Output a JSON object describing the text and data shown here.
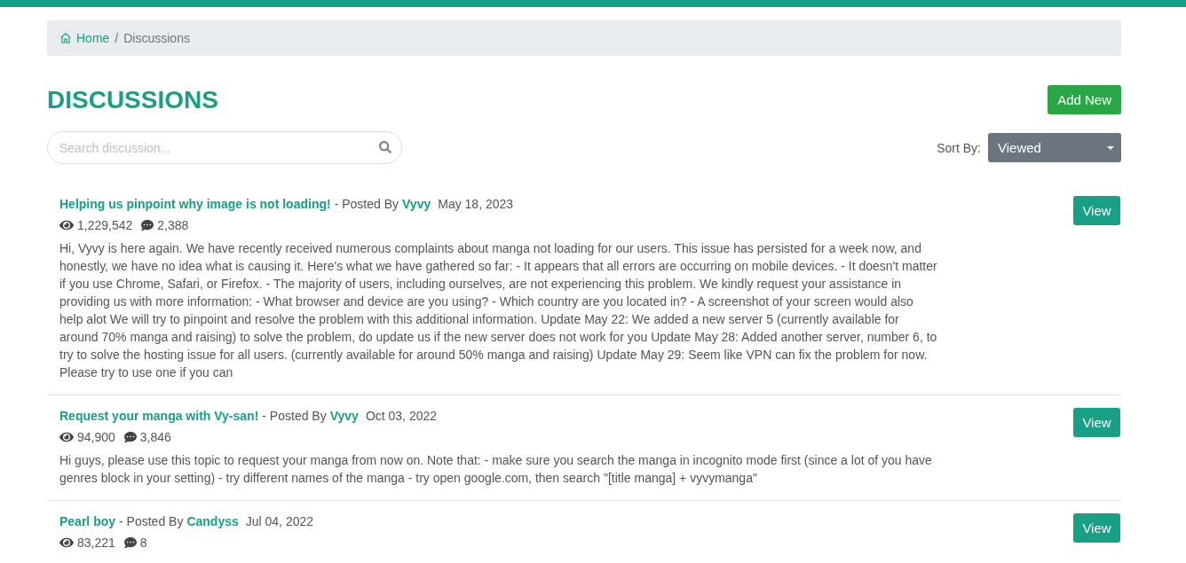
{
  "breadcrumb": {
    "separator": "/",
    "items": [
      {
        "label": "Home",
        "kind": "link"
      },
      {
        "label": "Discussions",
        "kind": "current"
      }
    ]
  },
  "page_title": "DISCUSSIONS",
  "add_button": "Add New",
  "search": {
    "placeholder": "Search discussion..."
  },
  "sort": {
    "label": "Sort By:",
    "value": "Viewed"
  },
  "topics": [
    {
      "title": "Helping us pinpoint why image is not loading!",
      "posted_by": "- Posted By",
      "author": "Vyvy",
      "date": "May 18, 2023",
      "views": "1,229,542",
      "comments": "2,388",
      "body": "Hi, Vyvy is here again. We have recently received numerous complaints about manga not loading for our users. This issue has persisted for a week now, and honestly, we have no idea what is causing it. Here's what we have gathered so far: - It appears that all errors are occurring on mobile devices. - It doesn't matter if you use Chrome, Safari, or Firefox. - The majority of users, including ourselves, are not experiencing this problem. We kindly request your assistance in providing us with more information: - What browser and device are you using? - Which country are you located in? - A screenshot of your screen would also help alot We will try to pinpoint and resolve the problem with this additional information. Update May 22: We added a new server 5 (currently available for around 70% manga and raising) to solve the problem, do update us if the new server does not work for you Update May 28: Added another server, number 6, to try to solve the hosting issue for all users. (currently available for around 50% manga and raising) Update May 29: Seem like VPN can fix the problem for now. Please try to use one if you can",
      "button": "View"
    },
    {
      "title": "Request your manga with Vy-san!",
      "posted_by": "- Posted By",
      "author": "Vyvy",
      "date": "Oct 03, 2022",
      "views": "94,900",
      "comments": "3,846",
      "body": "Hi guys, please use this topic to request your manga from now on. Note that: - make sure you search the manga in incognito mode first (since a lot of you have genres block in your setting) - try different names of the manga - try open google.com, then search \"[title manga] + vyvymanga\"",
      "button": "View"
    },
    {
      "title": "Pearl boy",
      "posted_by": "- Posted By",
      "author": "Candyss",
      "date": "Jul 04, 2022",
      "views": "83,221",
      "comments": "8",
      "button": "View"
    }
  ]
}
